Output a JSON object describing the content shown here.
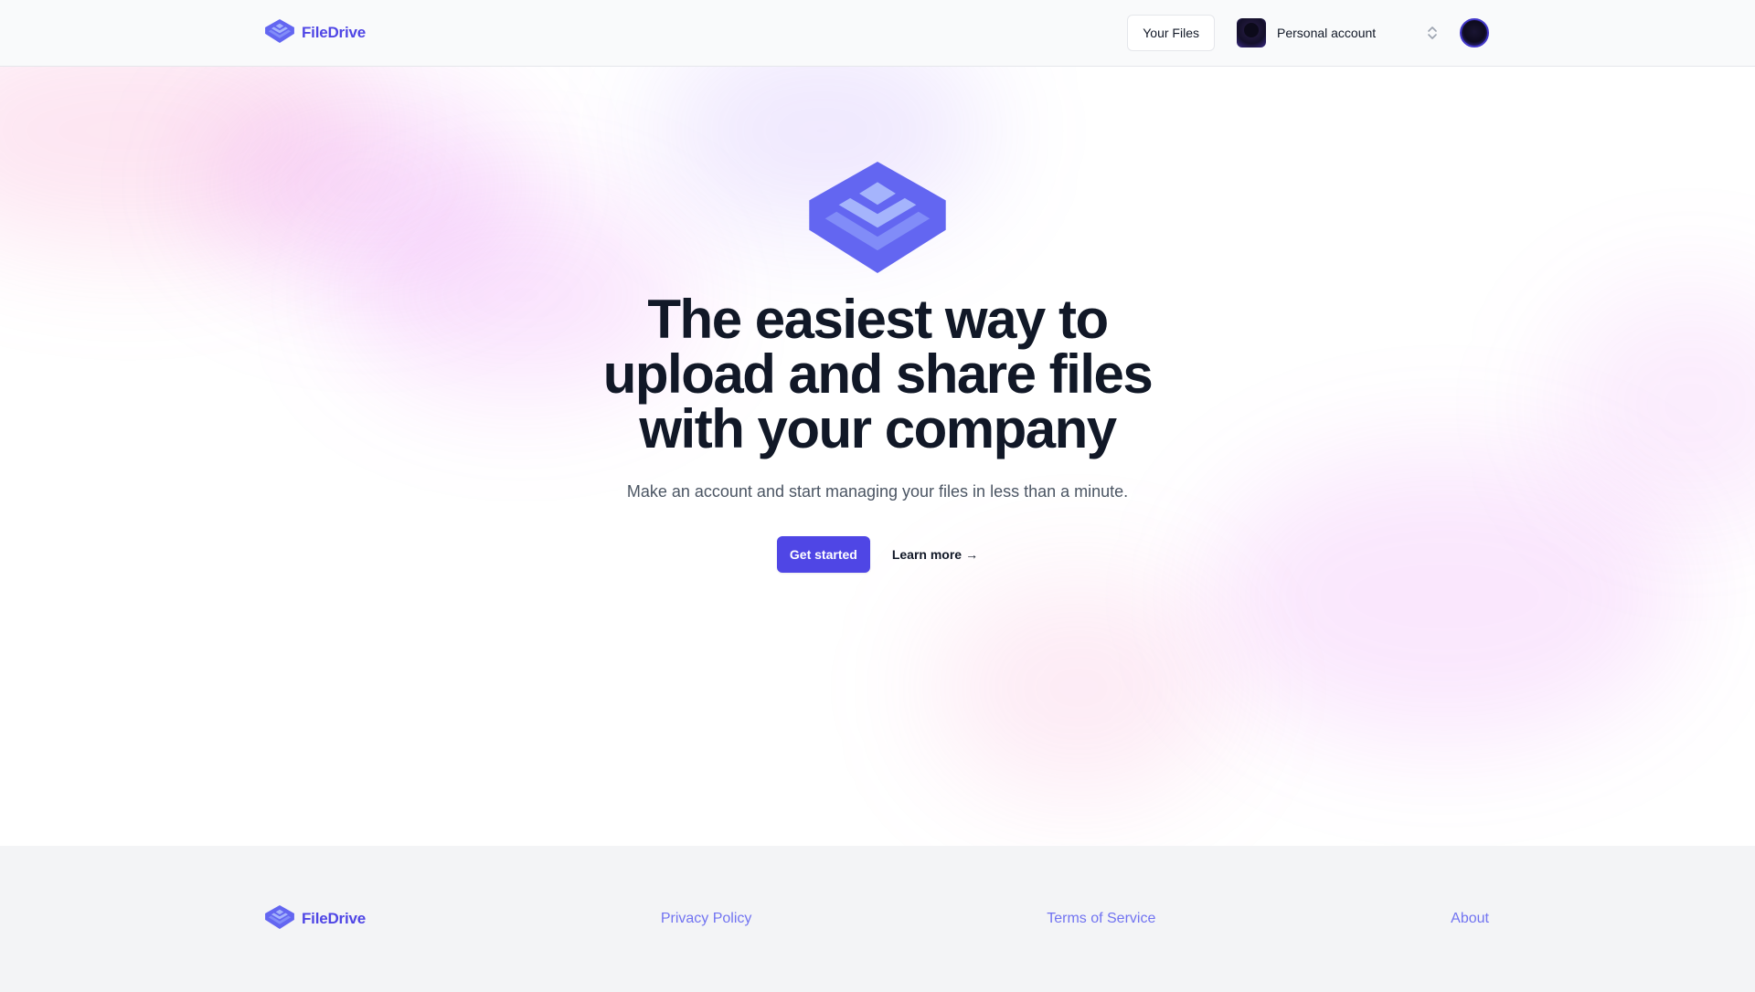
{
  "header": {
    "brand": "FileDrive",
    "your_files_label": "Your Files",
    "org_name": "Personal account",
    "icons": {
      "logo": "layers-logo-icon",
      "org_chevron": "chevron-up-down-icon"
    }
  },
  "hero": {
    "title": "The easiest way to upload and share files with your company",
    "subtitle": "Make an account and start managing your files in less than a minute.",
    "cta_primary": "Get started",
    "cta_secondary": "Learn more",
    "cta_secondary_arrow": "→"
  },
  "footer": {
    "brand": "FileDrive",
    "links": [
      "Privacy Policy",
      "Terms of Service",
      "About"
    ]
  },
  "colors": {
    "accent": "#4f46e5",
    "logo_light": "#818cf8",
    "text": "#111827",
    "muted": "#4b5563",
    "footer_bg": "#f3f4f6"
  }
}
